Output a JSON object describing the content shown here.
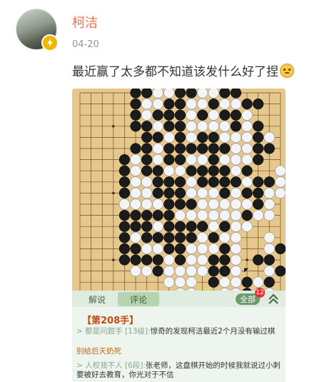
{
  "post": {
    "username": "柯洁",
    "date": "04-20",
    "text": "最近赢了太多都不知道该发什么好了捏"
  },
  "icons": {
    "avatar": "user-avatar-photo",
    "badge": "verified-lightning-badge",
    "emoji": "awkward-smile-emoji",
    "collapse": "double-chevron-up-icon"
  },
  "colors": {
    "username": "#eb7350",
    "board": "#e7c88c",
    "panel": "#eef5ef",
    "accent_red": "#e5312f"
  },
  "board": {
    "rows": [
      ".....XXWWXXWWXX....",
      ".....XWWXXOWXWWXX..",
      ".....XOXXXOXWXXO...",
      ".....XXOXXOWWOXOX..",
      "......XXOXOXXOWOXO.",
      ".....XXOXXXXXXOOXX.",
      "....XWXWXXOWXOOWX..",
      "....XOXXOOXXXXWX..O",
      "....XOOXXXOXXXXOXXW",
      "....XWWXXXOWOXOXXWW",
      "....WWWWXXXWWWWWXW.",
      "....XXXXXWWWWWWXOW.",
      "....XXXWXXXXWXOO...",
      "....XWXXXXXWXWO..O.",
      "....XXWWXXWWWXO..WX",
      "....XXXXWXWWXXO.XX.",
      ".....WWXWWWWXXW..OX",
      "........WWW.XWWXWX.",
      ".........OO..OOXOW."
    ],
    "last_move": [
      16,
      15
    ]
  },
  "panel": {
    "tabs": [
      "解说",
      "评论"
    ],
    "all_button": "全部",
    "badge_count": "12",
    "move_title": "【第208手】",
    "comments": [
      {
        "author": "都是问题手 [13级]:",
        "text": "惊奇的发现柯洁最近2个月没有输过棋"
      },
      {
        "author": "",
        "text": "别给后天奶死"
      },
      {
        "author": "人权我不人 [6段]:",
        "text": "张老师，这盘棋开始的时候我就说过小刺要被好去教育，你光对于不信"
      }
    ]
  }
}
